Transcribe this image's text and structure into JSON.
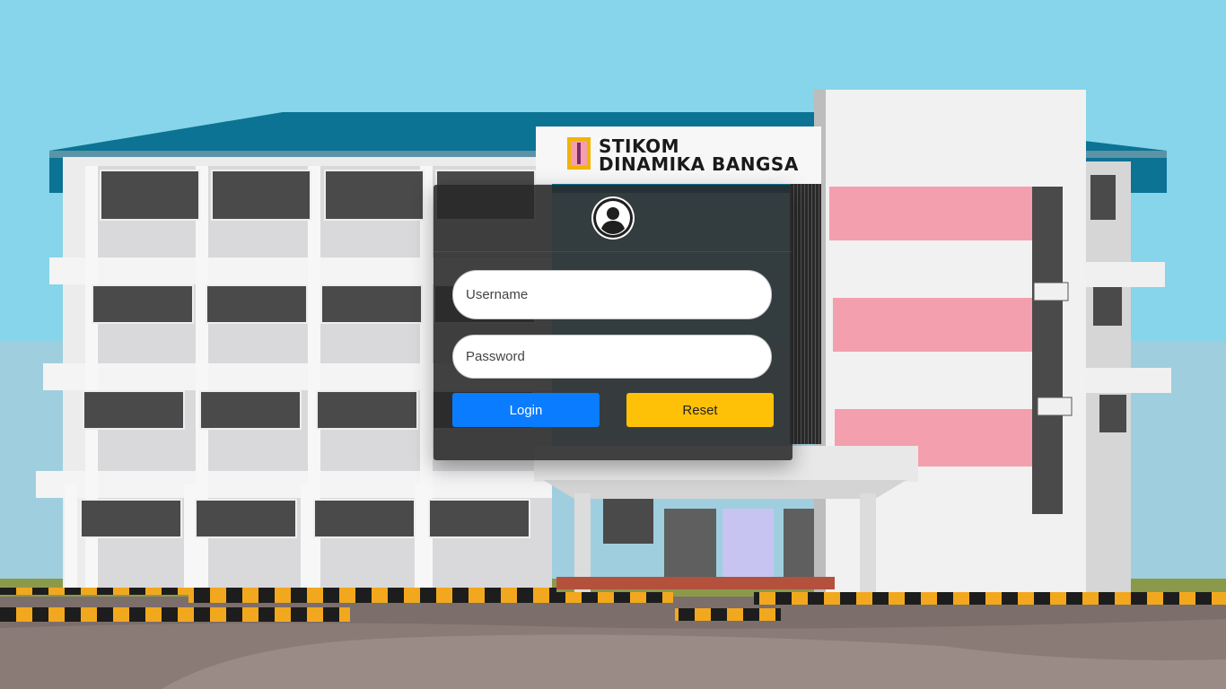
{
  "campus_sign": {
    "line1": "STIKOM",
    "line2": "DINAMIKA BANGSA"
  },
  "login": {
    "avatar_icon": "user-circle-icon",
    "username_placeholder": "Username",
    "password_placeholder": "Password",
    "login_label": "Login",
    "reset_label": "Reset"
  },
  "colors": {
    "sky": "#86d5ea",
    "roof": "#0c7394",
    "panel": "#2b2b2b",
    "login_button": "#0a7cff",
    "reset_button": "#ffc107",
    "accent_pink": "#f49fae"
  }
}
